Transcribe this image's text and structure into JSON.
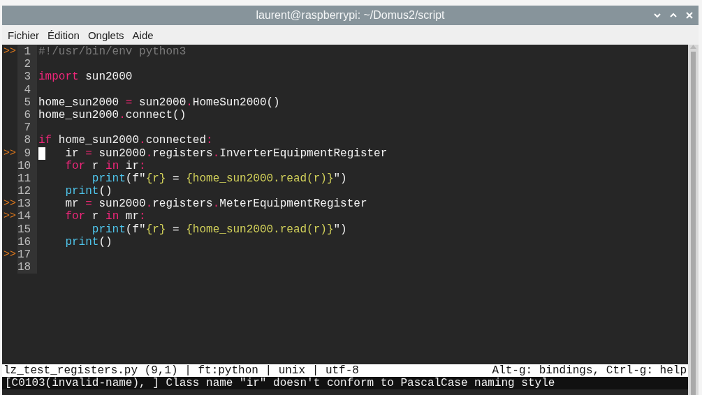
{
  "window": {
    "title": "laurent@raspberrypi: ~/Domus2/script"
  },
  "menu": [
    "Fichier",
    "Édition",
    "Onglets",
    "Aide"
  ],
  "editor": {
    "lines": [
      {
        "number": "1",
        "marker": ">>",
        "tokens": [
          {
            "kind": "comment",
            "text": "#!/usr/bin/env python3"
          }
        ]
      },
      {
        "number": "2"
      },
      {
        "number": "3",
        "tokens": [
          {
            "kind": "keyword",
            "text": "import"
          },
          {
            "kind": "name",
            "text": " sun2000"
          }
        ]
      },
      {
        "number": "4"
      },
      {
        "number": "5",
        "tokens": [
          {
            "kind": "name",
            "text": "home_sun2000 "
          },
          {
            "kind": "operator",
            "text": "="
          },
          {
            "kind": "name",
            "text": " sun2000"
          },
          {
            "kind": "operator",
            "text": "."
          },
          {
            "kind": "name",
            "text": "HomeSun2000()"
          }
        ]
      },
      {
        "number": "6",
        "tokens": [
          {
            "kind": "name",
            "text": "home_sun2000"
          },
          {
            "kind": "operator",
            "text": "."
          },
          {
            "kind": "name",
            "text": "connect()"
          }
        ]
      },
      {
        "number": "7"
      },
      {
        "number": "8",
        "tokens": [
          {
            "kind": "keyword",
            "text": "if"
          },
          {
            "kind": "name",
            "text": " home_sun2000"
          },
          {
            "kind": "operator",
            "text": "."
          },
          {
            "kind": "name",
            "text": "connected"
          },
          {
            "kind": "operator",
            "text": ":"
          }
        ]
      },
      {
        "number": "9",
        "marker": ">>",
        "cursor": true,
        "tokens": [
          {
            "kind": "name",
            "text": "    ir "
          },
          {
            "kind": "operator",
            "text": "="
          },
          {
            "kind": "name",
            "text": " sun2000"
          },
          {
            "kind": "operator",
            "text": "."
          },
          {
            "kind": "name",
            "text": "registers"
          },
          {
            "kind": "operator",
            "text": "."
          },
          {
            "kind": "name",
            "text": "InverterEquipmentRegister"
          }
        ]
      },
      {
        "number": "10",
        "tokens": [
          {
            "kind": "keyword",
            "text": "    for"
          },
          {
            "kind": "name",
            "text": " r "
          },
          {
            "kind": "keyword",
            "text": "in"
          },
          {
            "kind": "name",
            "text": " ir"
          },
          {
            "kind": "operator",
            "text": ":"
          }
        ]
      },
      {
        "number": "11",
        "tokens": [
          {
            "kind": "function",
            "text": "        print"
          },
          {
            "kind": "name",
            "text": "(f\""
          },
          {
            "kind": "string",
            "text": "{r}"
          },
          {
            "kind": "name",
            "text": " = "
          },
          {
            "kind": "string",
            "text": "{home_sun2000.read(r)}"
          },
          {
            "kind": "name",
            "text": "\")"
          }
        ]
      },
      {
        "number": "12",
        "tokens": [
          {
            "kind": "function",
            "text": "    print"
          },
          {
            "kind": "name",
            "text": "()"
          }
        ]
      },
      {
        "number": "13",
        "marker": ">>",
        "tokens": [
          {
            "kind": "name",
            "text": "    mr "
          },
          {
            "kind": "operator",
            "text": "="
          },
          {
            "kind": "name",
            "text": " sun2000"
          },
          {
            "kind": "operator",
            "text": "."
          },
          {
            "kind": "name",
            "text": "registers"
          },
          {
            "kind": "operator",
            "text": "."
          },
          {
            "kind": "name",
            "text": "MeterEquipmentRegister"
          }
        ]
      },
      {
        "number": "14",
        "marker": ">>",
        "tokens": [
          {
            "kind": "keyword",
            "text": "    for"
          },
          {
            "kind": "name",
            "text": " r "
          },
          {
            "kind": "keyword",
            "text": "in"
          },
          {
            "kind": "name",
            "text": " mr"
          },
          {
            "kind": "operator",
            "text": ":"
          }
        ]
      },
      {
        "number": "15",
        "tokens": [
          {
            "kind": "function",
            "text": "        print"
          },
          {
            "kind": "name",
            "text": "(f\""
          },
          {
            "kind": "string",
            "text": "{r}"
          },
          {
            "kind": "name",
            "text": " = "
          },
          {
            "kind": "string",
            "text": "{home_sun2000.read(r)}"
          },
          {
            "kind": "name",
            "text": "\")"
          }
        ]
      },
      {
        "number": "16",
        "tokens": [
          {
            "kind": "function",
            "text": "    print"
          },
          {
            "kind": "name",
            "text": "()"
          }
        ]
      },
      {
        "number": "17",
        "marker": ">>"
      },
      {
        "number": "18"
      }
    ]
  },
  "status_bar": {
    "left": "lz_test_registers.py (9,1) | ft:python | unix | utf-8",
    "right": "Alt-g: bindings, Ctrl-g: help"
  },
  "message": "[C0103(invalid-name), ] Class name \"ir\" doesn't conform to PascalCase naming style"
}
